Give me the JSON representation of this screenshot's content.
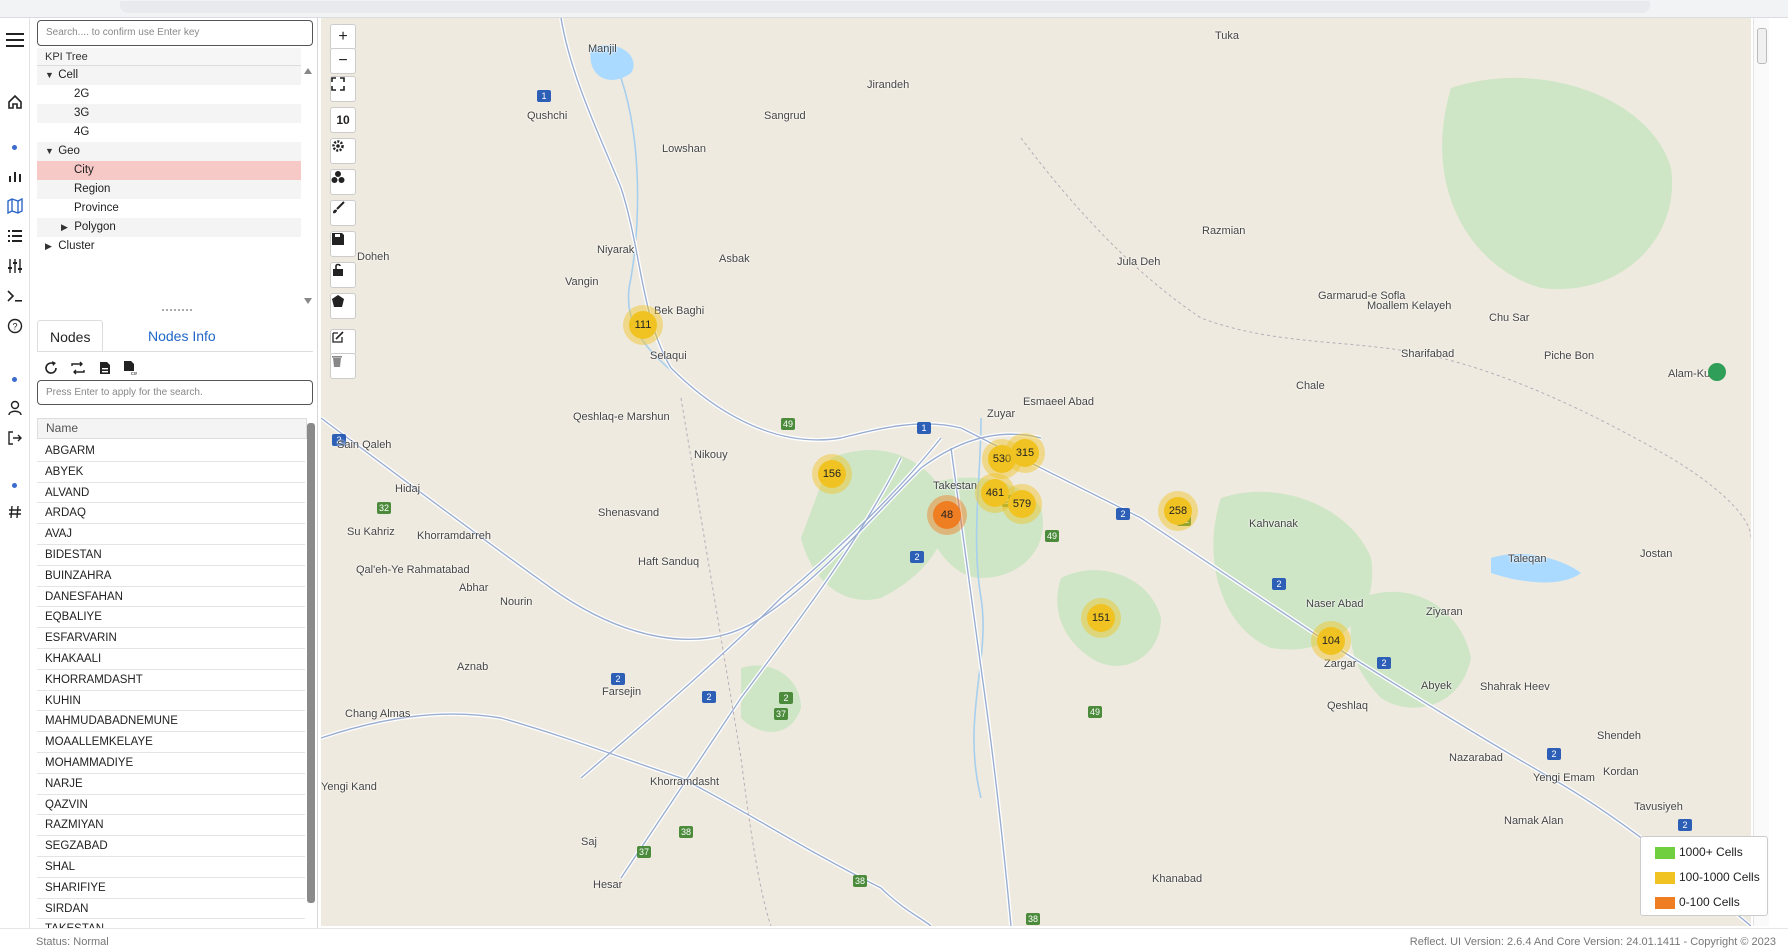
{
  "kpi_tree": {
    "search_placeholder": "Search.... to confirm use Enter key",
    "header": "KPI Tree",
    "items": [
      {
        "label": "Cell",
        "caret": "▼"
      },
      {
        "label": "2G"
      },
      {
        "label": "3G"
      },
      {
        "label": "4G"
      },
      {
        "label": "Geo",
        "caret": "▼"
      },
      {
        "label": "City"
      },
      {
        "label": "Region"
      },
      {
        "label": "Province"
      },
      {
        "label": "Polygon",
        "caret": "▶"
      },
      {
        "label": "Cluster",
        "caret": "▶"
      }
    ]
  },
  "tabs": {
    "nodes": "Nodes",
    "nodes_info": "Nodes Info"
  },
  "nodes": {
    "search_placeholder": "Press Enter to apply for the search.",
    "column": "Name",
    "items": [
      "ABGARM",
      "ABYEK",
      "ALVAND",
      "ARDAQ",
      "AVAJ",
      "BIDESTAN",
      "BUINZAHRA",
      "DANESFAHAN",
      "EQBALIYE",
      "ESFARVARIN",
      "KHAKAALI",
      "KHORRAMDASHT",
      "KUHIN",
      "MAHMUDABADNEMUNE",
      "MOAALLEMKELAYE",
      "MOHAMMADIYE",
      "NARJE",
      "QAZVIN",
      "RAZMIYAN",
      "SEGZABAD",
      "SHAL",
      "SHARIFIYE",
      "SIRDAN",
      "TAKESTAN"
    ]
  },
  "map": {
    "zoom_level": "10",
    "clusters": [
      {
        "label": "111",
        "kind": "mid"
      },
      {
        "label": "156",
        "kind": "mid"
      },
      {
        "label": "48",
        "kind": "low"
      },
      {
        "label": "530",
        "kind": "mid"
      },
      {
        "label": "315",
        "kind": "mid"
      },
      {
        "label": "461",
        "kind": "mid"
      },
      {
        "label": "579",
        "kind": "mid"
      },
      {
        "label": "258",
        "kind": "mid"
      },
      {
        "label": "151",
        "kind": "mid"
      },
      {
        "label": "104",
        "kind": "mid"
      }
    ],
    "places": [
      "Manjil",
      "Qushchi",
      "Lowshan",
      "Sangrud",
      "Jirandeh",
      "Niyarak",
      "Asbak",
      "Vangin",
      "Doheh",
      "Bek Baghi",
      "Selaqui",
      "Qeshlaq-e Marshun",
      "Nikouy",
      "Sain Qaleh",
      "Hidaj",
      "Su Kahriz",
      "Khorramdarreh",
      "Qal'eh-Ye Rahmatabad",
      "Abhar",
      "Shenasvand",
      "Haft Sanduq",
      "Nourin",
      "Aznab",
      "Chang Almas",
      "Farsejin",
      "Khorramdasht",
      "Saj",
      "Hesar",
      "Yengi Kand",
      "Zuyar",
      "Esmaeel Abad",
      "Razmian",
      "Jula Deh",
      "Garmarud-e Sofla",
      "Moallem Kelayeh",
      "Chu Sar",
      "Sharifabad",
      "Chale",
      "Piche Bon",
      "Alam-Kuh",
      "Kahvanak",
      "Naser Abad",
      "Zargar",
      "Ziyaran",
      "Taleqan",
      "Jostan",
      "Abyek",
      "Shahrak Heev",
      "Qeshlaq",
      "Nazarabad",
      "Yengi Emam",
      "Shendeh",
      "Kordan",
      "Tavusiyeh",
      "Namak Alan",
      "Khanabad",
      "Takestan",
      "Tuka"
    ],
    "legend": [
      {
        "label": "1000+ Cells",
        "color": "#6fcf3e"
      },
      {
        "label": "100-1000 Cells",
        "color": "#f0c322"
      },
      {
        "label": "0-100 Cells",
        "color": "#ef7d22"
      }
    ]
  },
  "status": {
    "left": "Status: Normal",
    "right": "Reflect. UI Version: 2.6.4 And Core Version: 24.01.1411 - Copyright © 2023"
  }
}
